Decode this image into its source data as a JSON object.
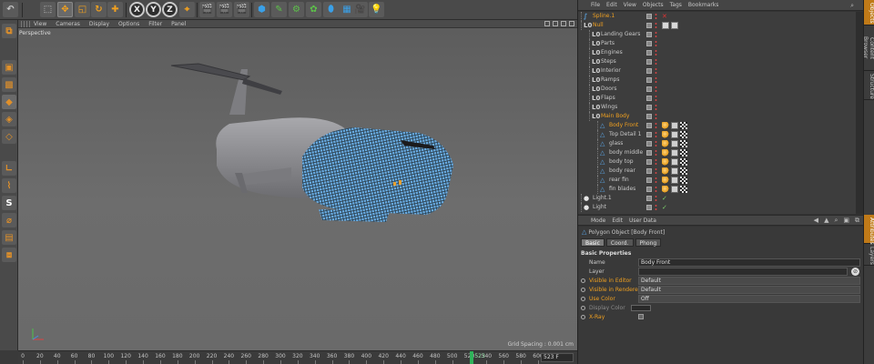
{
  "toolbar": {
    "axis_x": "X",
    "axis_y": "Y",
    "axis_z": "Z"
  },
  "viewport": {
    "menu": [
      "View",
      "Cameras",
      "Display",
      "Options",
      "Filter",
      "Panel"
    ],
    "label": "Perspective",
    "grid_spacing": "Grid Spacing : 0.001 cm"
  },
  "timeline": {
    "ticks": [
      "0",
      "20",
      "40",
      "60",
      "80",
      "100",
      "120",
      "140",
      "160",
      "180",
      "200",
      "220",
      "240",
      "260",
      "280",
      "300",
      "320",
      "340",
      "360",
      "380",
      "400",
      "420",
      "440",
      "460",
      "480",
      "500",
      "520",
      "540",
      "560",
      "580",
      "600"
    ],
    "current_frame": "523",
    "frame_field": "523 F"
  },
  "object_manager": {
    "menu": [
      "File",
      "Edit",
      "View",
      "Objects",
      "Tags",
      "Bookmarks"
    ],
    "rows": [
      {
        "name": "Spline.1",
        "icon": "spline",
        "depth": 0,
        "highlight": true
      },
      {
        "name": "Null",
        "icon": "null",
        "depth": 0,
        "highlight": true
      },
      {
        "name": "Landing Gears",
        "icon": "null",
        "depth": 1,
        "highlight": false
      },
      {
        "name": "Parts",
        "icon": "null",
        "depth": 1,
        "highlight": false
      },
      {
        "name": "Engines",
        "icon": "null",
        "depth": 1,
        "highlight": false
      },
      {
        "name": "Steps",
        "icon": "null",
        "depth": 1,
        "highlight": false
      },
      {
        "name": "Interior",
        "icon": "null",
        "depth": 1,
        "highlight": false
      },
      {
        "name": "Ramps",
        "icon": "null",
        "depth": 1,
        "highlight": false
      },
      {
        "name": "Doors",
        "icon": "null",
        "depth": 1,
        "highlight": false
      },
      {
        "name": "Flaps",
        "icon": "null",
        "depth": 1,
        "highlight": false
      },
      {
        "name": "Wings",
        "icon": "null",
        "depth": 1,
        "highlight": false
      },
      {
        "name": "Main Body",
        "icon": "null",
        "depth": 1,
        "highlight": true
      },
      {
        "name": "Body Front",
        "icon": "polygon",
        "depth": 2,
        "highlight": true
      },
      {
        "name": "Top Detail 1",
        "icon": "polygon",
        "depth": 2,
        "highlight": false
      },
      {
        "name": "glass",
        "icon": "polygon",
        "depth": 2,
        "highlight": false
      },
      {
        "name": "body middle",
        "icon": "polygon",
        "depth": 2,
        "highlight": false
      },
      {
        "name": "body top",
        "icon": "polygon",
        "depth": 2,
        "highlight": false
      },
      {
        "name": "body rear",
        "icon": "polygon",
        "depth": 2,
        "highlight": false
      },
      {
        "name": "rear fin",
        "icon": "polygon",
        "depth": 2,
        "highlight": false
      },
      {
        "name": "fin blades",
        "icon": "polygon",
        "depth": 2,
        "highlight": false
      },
      {
        "name": "Light.1",
        "icon": "light",
        "depth": 0,
        "highlight": false
      },
      {
        "name": "Light",
        "icon": "light",
        "depth": 0,
        "highlight": false
      }
    ]
  },
  "attributes": {
    "menu": [
      "Mode",
      "Edit",
      "User Data"
    ],
    "title": "Polygon Object [Body Front]",
    "tabs": [
      "Basic",
      "Coord.",
      "Phong"
    ],
    "section": "Basic Properties",
    "props": {
      "name_label": "Name",
      "name_value": "Body Front",
      "layer_label": "Layer",
      "vis_editor_label": "Visible in Editor",
      "vis_editor_value": "Default",
      "vis_render_label": "Visible in Renderer",
      "vis_render_value": "Default",
      "use_color_label": "Use Color",
      "use_color_value": "Off",
      "display_color_label": "Display Color",
      "xray_label": "X-Ray"
    }
  },
  "side_tabs": [
    "Objects",
    "Content Browser",
    "Structure",
    "Attributes",
    "Layers"
  ],
  "colors": {
    "accent": "#f0a020",
    "playhead": "#2fb35a",
    "wire": "#5aa2e0"
  }
}
